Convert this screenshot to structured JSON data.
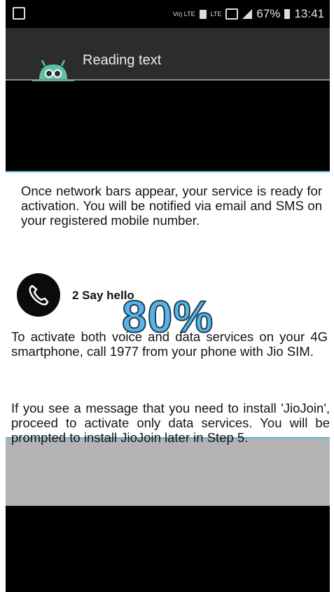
{
  "statusbar": {
    "volte": "Vo)\nLTE",
    "lte": "LTE",
    "battery": "67%",
    "time": "13:41"
  },
  "appbar": {
    "title": "Reading text"
  },
  "snapshot": {
    "paragraph_1": "Once network bars appear, your service is ready for activation. You will be notified via email and SMS on your registered mobile number.",
    "step_title": "2 Say hello",
    "paragraph_2": "To activate both voice and data services on your 4G smartphone, call 1977 from your phone with Jio SIM.",
    "paragraph_3": "If you see a message that you need to install 'JioJoin', proceed to activate only data services. You will be prompted to install JioJoin later in Step 5."
  },
  "overlay": {
    "progress_text": "80%",
    "progress_value": 0.8
  }
}
